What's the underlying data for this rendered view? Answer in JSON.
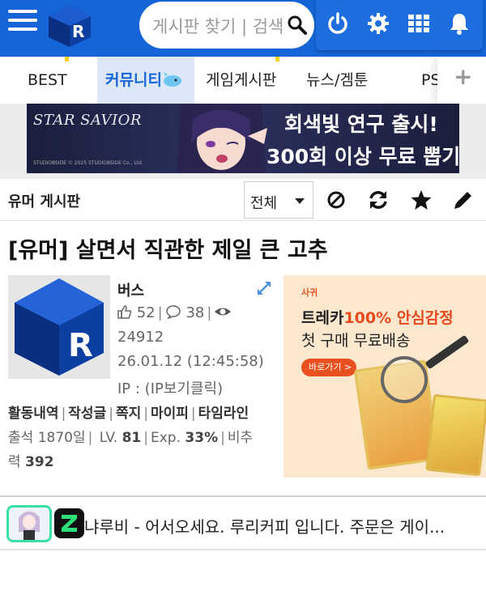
{
  "header": {
    "search_placeholder": "게시판 찾기 | 검색"
  },
  "tabs": [
    {
      "label": "BEST"
    },
    {
      "label": "커뮤니티"
    },
    {
      "label": "게임게시판"
    },
    {
      "label": "뉴스/겜툰"
    },
    {
      "label": "PS"
    }
  ],
  "tab_add_label": "+",
  "banner": {
    "logo_text": "STAR SAVIOR",
    "copyright": "STUDIOBSIDE © 2025 STUDIOBSIDE Co., Ltd.",
    "line1": "회색빛 연구 출시!",
    "line2": "300회 이상 무료 뽑기!"
  },
  "board": {
    "title": "유머 게시판",
    "filter_selected": "전체"
  },
  "post": {
    "title": "[유머] 살면서 직관한 제일 큰 고추",
    "author": "버스",
    "likes": "52",
    "comments": "38",
    "views": "24912",
    "date": "26.01.12 (12:45:58)",
    "ip": "IP : (IP보기클릭)",
    "links": [
      "활동내역",
      "작성글",
      "쪽지",
      "마이피",
      "타임라인"
    ],
    "attendance_label": "출석",
    "attendance_value": "1870일",
    "level_label": "LV.",
    "level_value": "81",
    "exp_label": "Exp.",
    "exp_value": "33%",
    "ratio_label_a": "비추",
    "ratio_label_b": "력",
    "ratio_value": "392"
  },
  "ad": {
    "brand": "사귀",
    "line1_a": "트레카",
    "line1_b": "100% 안심감정",
    "line2": "첫 구매 무료배송",
    "button": "바로가기 >"
  },
  "comment": {
    "text": "냐루비 - 어서오세요. 루리커피 입니다. 주문은 게이..."
  },
  "colors": {
    "brand_blue": "#1565d8",
    "active_tab_bg": "#dce8f8",
    "ad_accent": "#e84a1f"
  },
  "icons": [
    "menu-icon",
    "search-icon",
    "power-icon",
    "gear-icon",
    "grid-icon",
    "bell-icon",
    "block-icon",
    "refresh-icon",
    "star-icon",
    "pencil-icon",
    "expand-icon",
    "thumbs-up-icon",
    "comment-icon",
    "eye-icon"
  ]
}
